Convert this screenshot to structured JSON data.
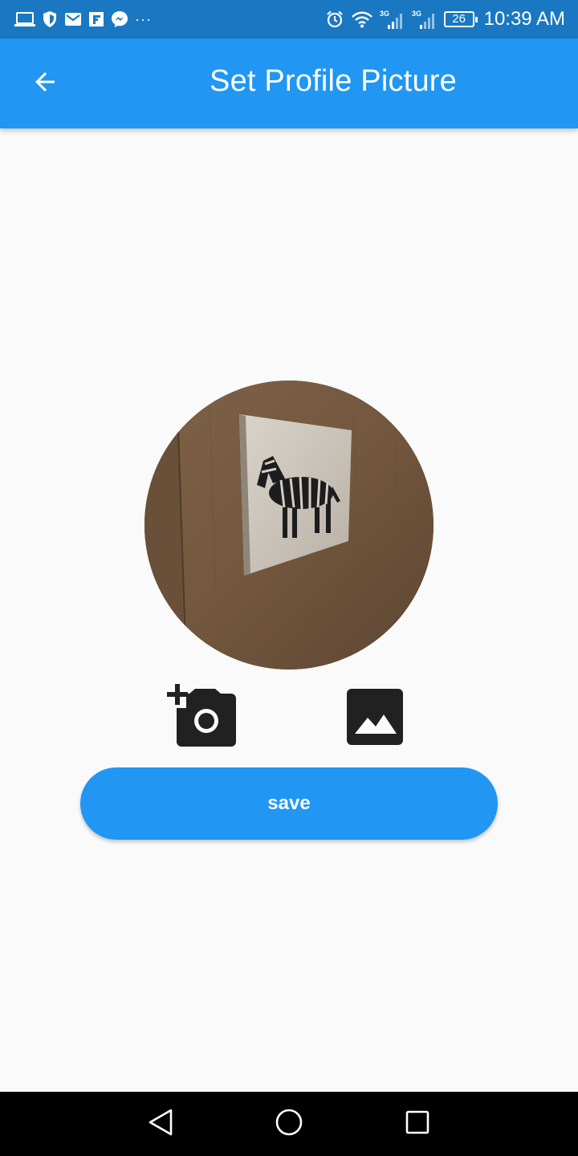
{
  "status_bar": {
    "time": "10:39 AM",
    "battery_level": "26",
    "network_left": "3G",
    "network_right": "3G",
    "notification_icons": [
      "laptop-icon",
      "shield-icon",
      "gmail-icon",
      "flipboard-icon",
      "messenger-icon",
      "more-dots-icon"
    ],
    "status_icons": [
      "alarm-icon",
      "wifi-icon",
      "signal-icon",
      "signal-icon",
      "battery-icon"
    ],
    "more_dots": "···"
  },
  "app_bar": {
    "title": "Set Profile Picture",
    "back_icon": "arrow-back-icon"
  },
  "profile": {
    "image": "zebra-print-on-wooden-door"
  },
  "actions": {
    "camera_icon": "add-a-photo-icon",
    "gallery_icon": "image-icon"
  },
  "save_button": {
    "label": "save"
  },
  "colors": {
    "primary": "#2196f3",
    "status_bar": "#1a78c2",
    "background": "#fafafa",
    "icon_dark": "#212121",
    "nav_bar": "#000000"
  },
  "nav_bar": {
    "icons": [
      "nav-back-icon",
      "nav-home-icon",
      "nav-recents-icon"
    ]
  }
}
